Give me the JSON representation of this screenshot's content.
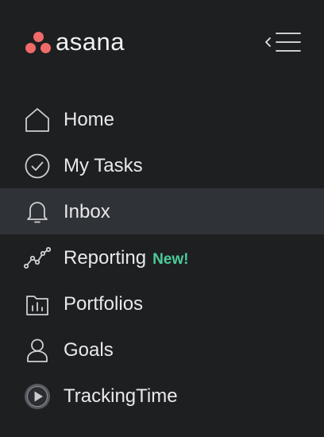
{
  "brand": {
    "name": "asana",
    "accent_color": "#f06a6a"
  },
  "header": {
    "collapse_icon": "collapse-sidebar-icon"
  },
  "nav": {
    "items": [
      {
        "label": "Home",
        "icon": "home-icon"
      },
      {
        "label": "My Tasks",
        "icon": "check-circle-icon"
      },
      {
        "label": "Inbox",
        "icon": "bell-icon",
        "active": true
      },
      {
        "label": "Reporting",
        "icon": "line-chart-icon",
        "badge": "New!"
      },
      {
        "label": "Portfolios",
        "icon": "folder-chart-icon"
      },
      {
        "label": "Goals",
        "icon": "person-icon"
      },
      {
        "label": "TrackingTime",
        "icon": "play-circle-icon"
      }
    ]
  },
  "colors": {
    "background": "#1e1f21",
    "active_row": "#2f3237",
    "badge": "#4ecb9a",
    "text": "#e9e9eb"
  }
}
